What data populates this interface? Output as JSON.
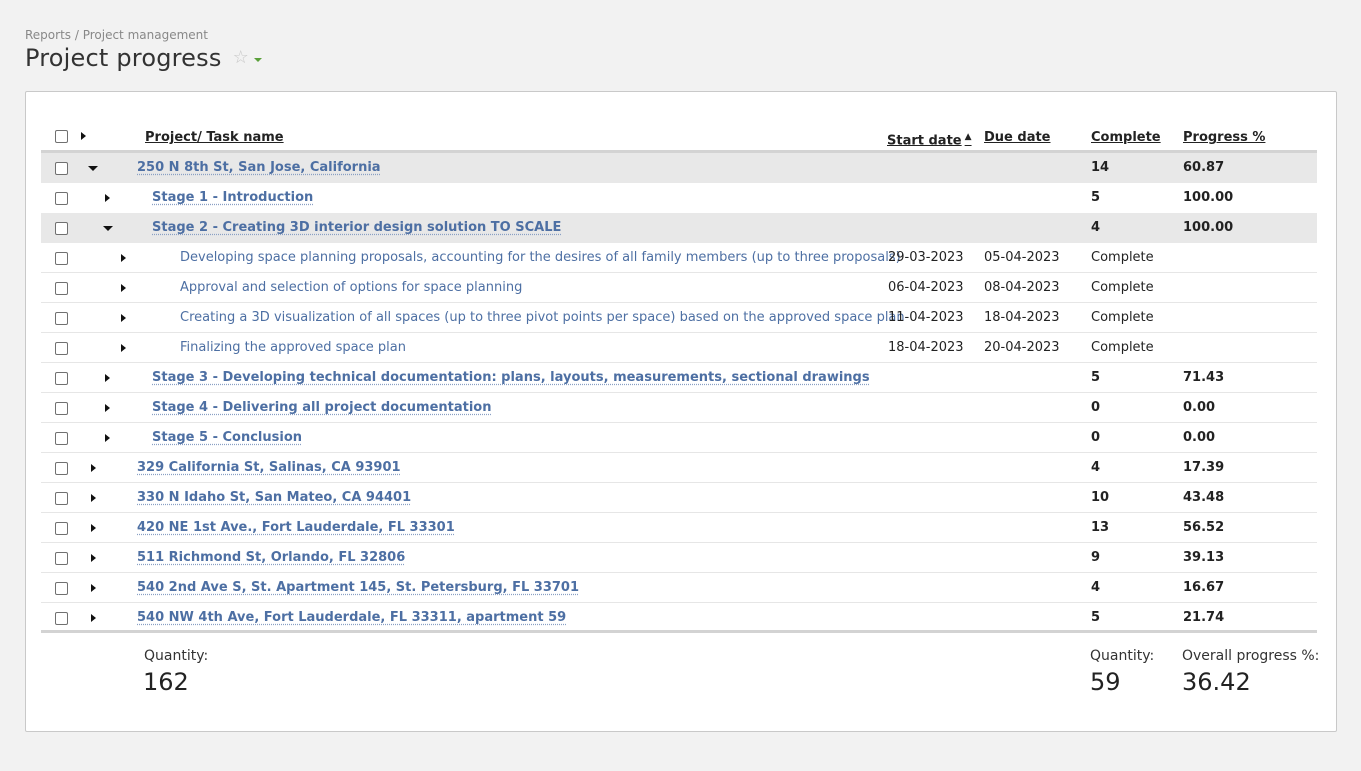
{
  "breadcrumb": "Reports / Project management",
  "page_title": "Project progress",
  "table": {
    "headers": {
      "name": "Project/ Task name",
      "start": "Start date",
      "due": "Due date",
      "complete": "Complete",
      "progress": "Progress %"
    },
    "rows": [
      {
        "name": "250 N 8th St, San Jose, California",
        "start": "",
        "due": "",
        "complete": "14",
        "progress": "60.87"
      },
      {
        "name": "Stage 1 - Introduction",
        "start": "",
        "due": "",
        "complete": "5",
        "progress": "100.00"
      },
      {
        "name": "Stage 2 - Creating 3D interior design solution TO SCALE",
        "start": "",
        "due": "",
        "complete": "4",
        "progress": "100.00"
      },
      {
        "name": "Developing space planning proposals, accounting for the desires of all family members (up to three proposals)",
        "start": "29-03-2023",
        "due": "05-04-2023",
        "complete": "Complete",
        "progress": ""
      },
      {
        "name": "Approval and selection of options for space planning",
        "start": "06-04-2023",
        "due": "08-04-2023",
        "complete": "Complete",
        "progress": ""
      },
      {
        "name": "Creating a 3D visualization of all spaces (up to three pivot points per space) based on the approved space plan",
        "start": "11-04-2023",
        "due": "18-04-2023",
        "complete": "Complete",
        "progress": ""
      },
      {
        "name": "Finalizing the approved space plan",
        "start": "18-04-2023",
        "due": "20-04-2023",
        "complete": "Complete",
        "progress": ""
      },
      {
        "name": "Stage 3 - Developing technical documentation: plans, layouts, measurements, sectional drawings",
        "start": "",
        "due": "",
        "complete": "5",
        "progress": "71.43"
      },
      {
        "name": "Stage 4 - Delivering all project documentation",
        "start": "",
        "due": "",
        "complete": "0",
        "progress": "0.00"
      },
      {
        "name": "Stage 5 - Conclusion",
        "start": "",
        "due": "",
        "complete": "0",
        "progress": "0.00"
      },
      {
        "name": "329 California St, Salinas, CA 93901",
        "start": "",
        "due": "",
        "complete": "4",
        "progress": "17.39"
      },
      {
        "name": "330 N Idaho St, San Mateo, CA 94401",
        "start": "",
        "due": "",
        "complete": "10",
        "progress": "43.48"
      },
      {
        "name": "420 NE 1st Ave., Fort Lauderdale, FL 33301",
        "start": "",
        "due": "",
        "complete": "13",
        "progress": "56.52"
      },
      {
        "name": "511 Richmond St, Orlando, FL 32806",
        "start": "",
        "due": "",
        "complete": "9",
        "progress": "39.13"
      },
      {
        "name": "540 2nd Ave S, St. Apartment 145, St. Petersburg, FL 33701",
        "start": "",
        "due": "",
        "complete": "4",
        "progress": "16.67"
      },
      {
        "name": "540 NW 4th Ave, Fort Lauderdale, FL 33311, apartment 59",
        "start": "",
        "due": "",
        "complete": "5",
        "progress": "21.74"
      }
    ]
  },
  "footer": {
    "quantity_label": "Quantity:",
    "quantity_value": "162",
    "complete_quantity_label": "Quantity:",
    "complete_quantity_value": "59",
    "overall_label": "Overall progress %:",
    "overall_value": "36.42"
  },
  "colors": {
    "link": "#4d6fa3",
    "star": "#c8c8c8",
    "caret": "#5aa03a",
    "expanded_row": "#e8e8e8"
  }
}
